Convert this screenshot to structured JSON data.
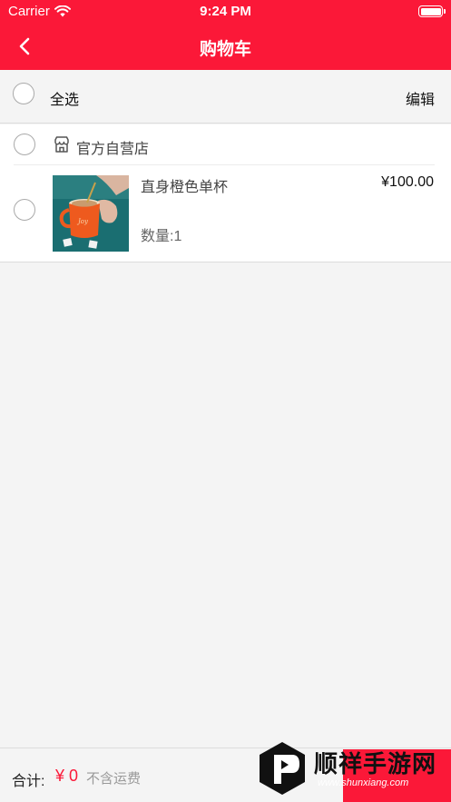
{
  "status_bar": {
    "carrier": "Carrier",
    "time": "9:24 PM"
  },
  "nav": {
    "title": "购物车",
    "back_icon": "chevron-left-icon"
  },
  "select_bar": {
    "select_all_label": "全选",
    "edit_label": "编辑"
  },
  "shop": {
    "name": "官方自营店",
    "icon": "store-icon"
  },
  "cart_items": [
    {
      "name": "直身橙色单杯",
      "price": "¥100.00",
      "quantity": "数量:1",
      "image": "orange-mug-photo"
    }
  ],
  "bottom_bar": {
    "total_label": "合计:",
    "total_amount": "¥ 0",
    "shipping_note": "不含运费"
  },
  "watermark": {
    "text": "顺祥手游网",
    "subtext": "www.shunxiang.com"
  },
  "colors": {
    "accent": "#fb1838",
    "background": "#f4f4f4",
    "card": "#ffffff",
    "muted_text": "#999999"
  }
}
